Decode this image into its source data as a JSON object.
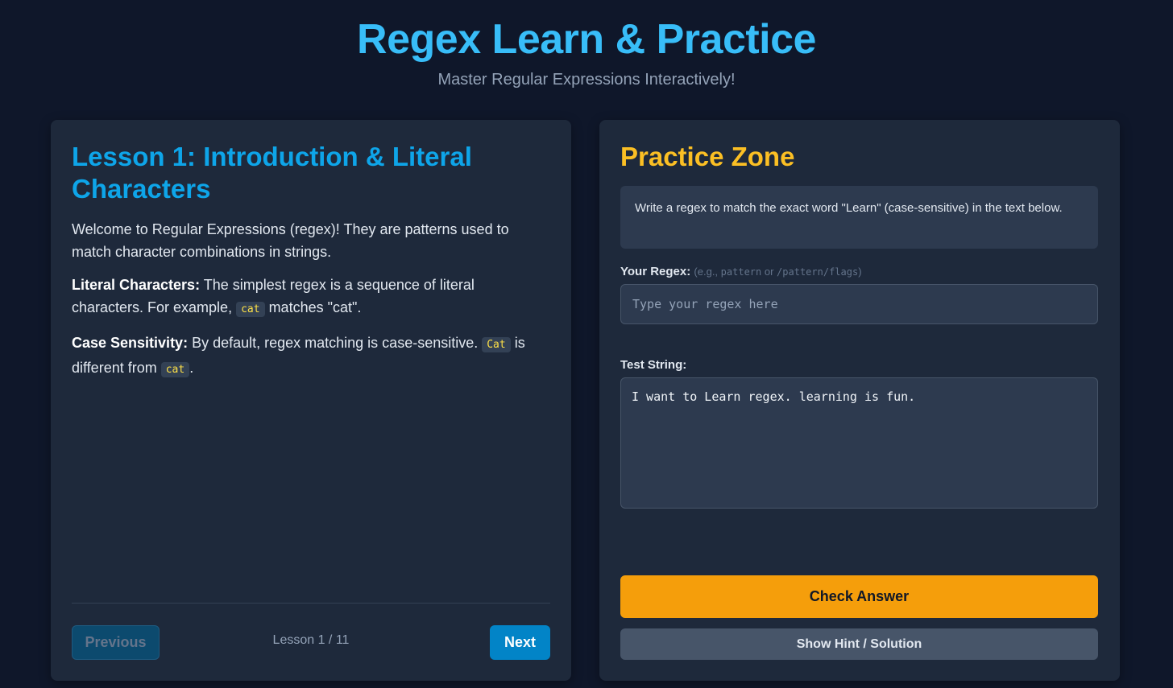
{
  "header": {
    "title": "Regex Learn & Practice",
    "subtitle": "Master Regular Expressions Interactively!"
  },
  "lesson": {
    "title": "Lesson 1: Introduction & Literal Characters",
    "intro": "Welcome to Regular Expressions (regex)! They are patterns used to match character combinations in strings.",
    "literal_heading": "Literal Characters:",
    "literal_text_1": " The simplest regex is a sequence of literal characters. For example, ",
    "literal_code": "cat",
    "literal_text_2": " matches \"cat\".",
    "case_heading": "Case Sensitivity:",
    "case_text_1": " By default, regex matching is case-sensitive. ",
    "case_code_1": "Cat",
    "case_text_2": " is different from ",
    "case_code_2": "cat",
    "case_text_3": ".",
    "prev_label": "Previous",
    "next_label": "Next",
    "counter": "Lesson 1 / 11"
  },
  "practice": {
    "title": "Practice Zone",
    "task": "Write a regex to match the exact word \"Learn\" (case-sensitive) in the text below.",
    "regex_label": "Your Regex:",
    "regex_hint_1": "(e.g., ",
    "regex_hint_mono_1": "pattern",
    "regex_hint_2": " or ",
    "regex_hint_mono_2": "/pattern/flags",
    "regex_hint_3": ")",
    "regex_placeholder": "Type your regex here",
    "regex_value": "",
    "test_label": "Test String:",
    "test_string": "I want to Learn regex. learning is fun.",
    "check_label": "Check Answer",
    "hint_label": "Show Hint / Solution"
  },
  "colors": {
    "background": "#0f172a",
    "panel": "#1e293b",
    "accent_blue": "#38bdf8",
    "accent_amber": "#f59e0b",
    "code_text": "#fde047"
  }
}
